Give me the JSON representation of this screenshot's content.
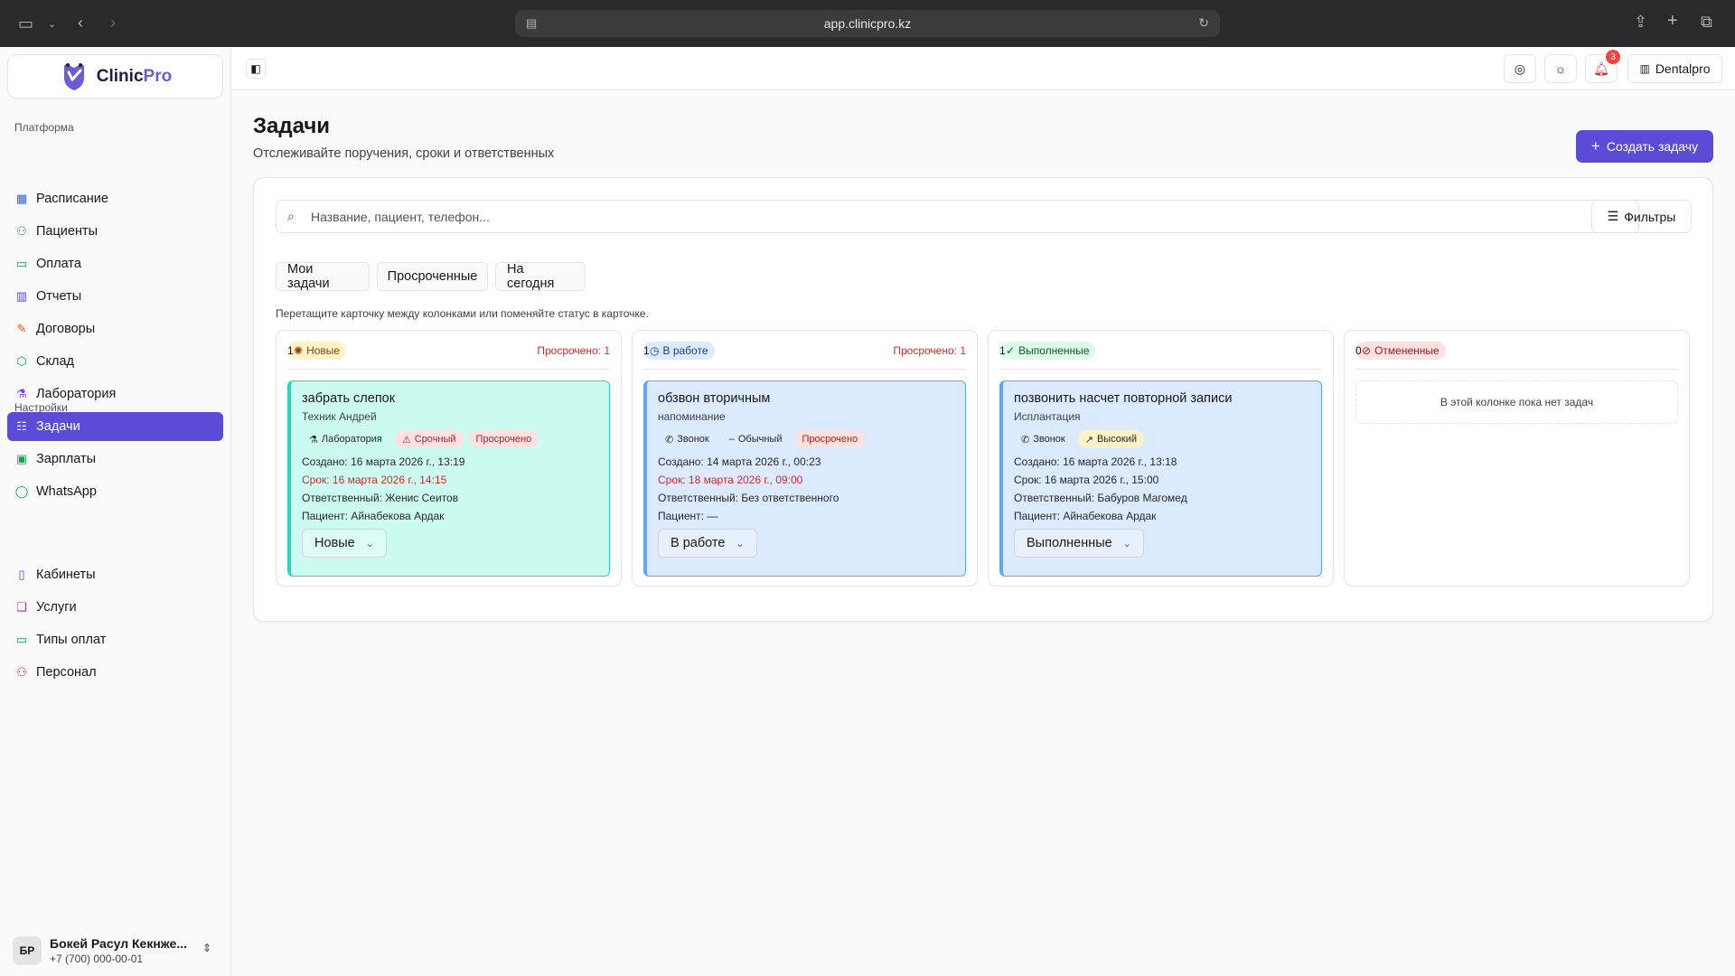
{
  "browser": {
    "url": "app.clinicpro.kz"
  },
  "app": {
    "logo_text": "Clinic",
    "logo_accent": "Pro"
  },
  "sidebar": {
    "group_platform": "Платформа",
    "platform_items": [
      {
        "label": "Расписание",
        "icon": "calendar-icon",
        "color": "#2563eb"
      },
      {
        "label": "Пациенты",
        "icon": "users-icon",
        "color": "#0891b2"
      },
      {
        "label": "Оплата",
        "icon": "credit-card-icon",
        "color": "#16a34a"
      },
      {
        "label": "Отчеты",
        "icon": "bar-chart-icon",
        "color": "#4f46e5"
      },
      {
        "label": "Договоры",
        "icon": "document-edit-icon",
        "color": "#ea580c"
      },
      {
        "label": "Склад",
        "icon": "box-icon",
        "color": "#16a34a"
      },
      {
        "label": "Лаборатория",
        "icon": "flask-icon",
        "color": "#7c3aed"
      },
      {
        "label": "Задачи",
        "icon": "tasks-icon",
        "color": "#ffffff"
      },
      {
        "label": "Зарплаты",
        "icon": "money-icon",
        "color": "#16a34a"
      },
      {
        "label": "WhatsApp",
        "icon": "whatsapp-icon",
        "color": "#16a34a"
      }
    ],
    "group_settings": "Настройки",
    "settings_items": [
      {
        "label": "Кабинеты",
        "icon": "map-icon",
        "color": "#4f46e5"
      },
      {
        "label": "Услуги",
        "icon": "book-icon",
        "color": "#7c3aed"
      },
      {
        "label": "Типы оплат",
        "icon": "wallet-icon",
        "color": "#16a34a"
      },
      {
        "label": "Персонал",
        "icon": "staff-icon",
        "color": "#e11d48"
      }
    ],
    "user": {
      "initials": "БР",
      "name": "Бокей Расул Кекнже...",
      "phone": "+7 (700) 000-00-01"
    }
  },
  "topbar": {
    "notification_count": "3",
    "clinic_name": "Dentalpro"
  },
  "page": {
    "title": "Задачи",
    "subtitle": "Отслеживайте поручения, сроки и ответственных",
    "create_label": "Создать задачу",
    "search_placeholder": "Название, пациент, телефон...",
    "filters_label": "Фильтры",
    "chips": [
      "Мои задачи",
      "Просроченные",
      "На сегодня"
    ],
    "hint": "Перетащите карточку между колонками или поменяйте статус в карточке."
  },
  "columns": [
    {
      "status": "Новые",
      "count": "1",
      "overdue": "Просрочено: 1",
      "pill_bg": "#fef3c7",
      "pill_fg": "#92400e",
      "card_bg": "#ccfbf1",
      "card_border": "#2dd4bf",
      "card": {
        "title": "забрать слепок",
        "desc": "Техник Андрей",
        "tags": [
          {
            "label": "Лаборатория",
            "icon": "flask-icon",
            "bg": "#ccfbf1"
          },
          {
            "label": "Срочный",
            "icon": "warning-icon",
            "bg": "#fee2e2"
          },
          {
            "label": "Просрочено",
            "icon": "",
            "bg": "#fee2e2"
          }
        ],
        "created": "Создано: 16 марта 2026 г., 13:19",
        "due": "Срок: 16 марта 2026 г., 14:15",
        "due_overdue": true,
        "assignee": "Ответственный: Женис Сеитов",
        "patient": "Пациент: Айнабекова Ардак",
        "select": "Новые"
      }
    },
    {
      "status": "В работе",
      "count": "1",
      "overdue": "Просрочено: 1",
      "pill_bg": "#dbeafe",
      "pill_fg": "#1e3a8a",
      "card_bg": "#dbeafe",
      "card_border": "#60a5fa",
      "card": {
        "title": "обзвон вторичным",
        "desc": "напоминание",
        "tags": [
          {
            "label": "Звонок",
            "icon": "phone-icon",
            "bg": "#dbeafe"
          },
          {
            "label": "Обычный",
            "icon": "minus-icon",
            "bg": "#dbeafe"
          },
          {
            "label": "Просрочено",
            "icon": "",
            "bg": "#fee2e2"
          }
        ],
        "created": "Создано: 14 марта 2026 г., 00:23",
        "due": "Срок: 18 марта 2026 г., 09:00",
        "due_overdue": true,
        "assignee": "Ответственный: Без ответственного",
        "patient": "Пациент: —",
        "select": "В работе"
      }
    },
    {
      "status": "Выполненные",
      "count": "1",
      "overdue": "",
      "pill_bg": "#dcfce7",
      "pill_fg": "#14532d",
      "card_bg": "#dbeafe",
      "card_border": "#60a5fa",
      "card": {
        "title": "позвонить насчет повторной записи",
        "desc": "Исплантация",
        "tags": [
          {
            "label": "Звонок",
            "icon": "phone-icon",
            "bg": "#dbeafe"
          },
          {
            "label": "Высокий",
            "icon": "trend-up-icon",
            "bg": "#fef3c7"
          }
        ],
        "created": "Создано: 16 марта 2026 г., 13:18",
        "due": "Срок: 16 марта 2026 г., 15:00",
        "due_overdue": false,
        "assignee": "Ответственный: Бабуров Магомед",
        "patient": "Пациент: Айнабекова Ардак",
        "select": "Выполненные"
      }
    },
    {
      "status": "Отмененные",
      "count": "0",
      "overdue": "",
      "pill_bg": "#fee2e2",
      "pill_fg": "#991b1b",
      "empty_text": "В этой колонке пока нет задач"
    }
  ]
}
